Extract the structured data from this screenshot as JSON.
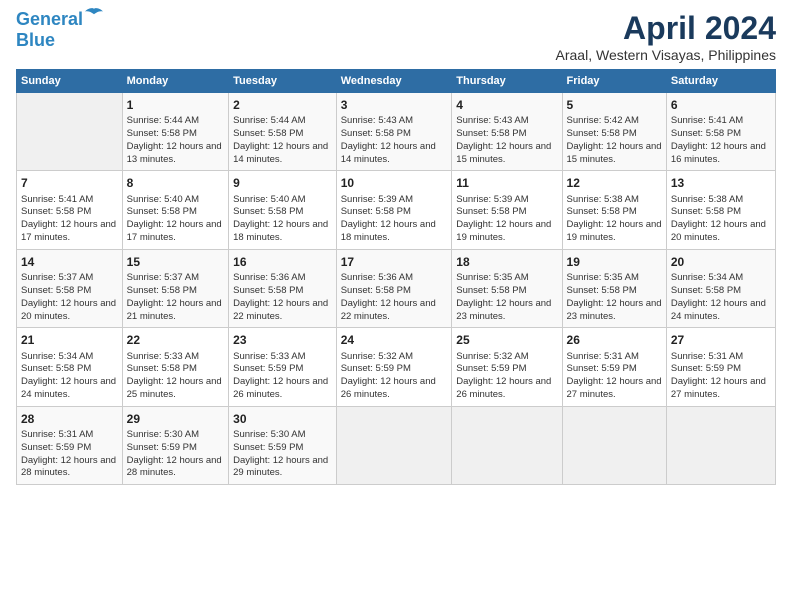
{
  "logo": {
    "line1": "General",
    "line2": "Blue"
  },
  "title": "April 2024",
  "subtitle": "Araal, Western Visayas, Philippines",
  "days_header": [
    "Sunday",
    "Monday",
    "Tuesday",
    "Wednesday",
    "Thursday",
    "Friday",
    "Saturday"
  ],
  "weeks": [
    [
      {
        "num": "",
        "sunrise": "",
        "sunset": "",
        "daylight": ""
      },
      {
        "num": "1",
        "sunrise": "Sunrise: 5:44 AM",
        "sunset": "Sunset: 5:58 PM",
        "daylight": "Daylight: 12 hours and 13 minutes."
      },
      {
        "num": "2",
        "sunrise": "Sunrise: 5:44 AM",
        "sunset": "Sunset: 5:58 PM",
        "daylight": "Daylight: 12 hours and 14 minutes."
      },
      {
        "num": "3",
        "sunrise": "Sunrise: 5:43 AM",
        "sunset": "Sunset: 5:58 PM",
        "daylight": "Daylight: 12 hours and 14 minutes."
      },
      {
        "num": "4",
        "sunrise": "Sunrise: 5:43 AM",
        "sunset": "Sunset: 5:58 PM",
        "daylight": "Daylight: 12 hours and 15 minutes."
      },
      {
        "num": "5",
        "sunrise": "Sunrise: 5:42 AM",
        "sunset": "Sunset: 5:58 PM",
        "daylight": "Daylight: 12 hours and 15 minutes."
      },
      {
        "num": "6",
        "sunrise": "Sunrise: 5:41 AM",
        "sunset": "Sunset: 5:58 PM",
        "daylight": "Daylight: 12 hours and 16 minutes."
      }
    ],
    [
      {
        "num": "7",
        "sunrise": "Sunrise: 5:41 AM",
        "sunset": "Sunset: 5:58 PM",
        "daylight": "Daylight: 12 hours and 17 minutes."
      },
      {
        "num": "8",
        "sunrise": "Sunrise: 5:40 AM",
        "sunset": "Sunset: 5:58 PM",
        "daylight": "Daylight: 12 hours and 17 minutes."
      },
      {
        "num": "9",
        "sunrise": "Sunrise: 5:40 AM",
        "sunset": "Sunset: 5:58 PM",
        "daylight": "Daylight: 12 hours and 18 minutes."
      },
      {
        "num": "10",
        "sunrise": "Sunrise: 5:39 AM",
        "sunset": "Sunset: 5:58 PM",
        "daylight": "Daylight: 12 hours and 18 minutes."
      },
      {
        "num": "11",
        "sunrise": "Sunrise: 5:39 AM",
        "sunset": "Sunset: 5:58 PM",
        "daylight": "Daylight: 12 hours and 19 minutes."
      },
      {
        "num": "12",
        "sunrise": "Sunrise: 5:38 AM",
        "sunset": "Sunset: 5:58 PM",
        "daylight": "Daylight: 12 hours and 19 minutes."
      },
      {
        "num": "13",
        "sunrise": "Sunrise: 5:38 AM",
        "sunset": "Sunset: 5:58 PM",
        "daylight": "Daylight: 12 hours and 20 minutes."
      }
    ],
    [
      {
        "num": "14",
        "sunrise": "Sunrise: 5:37 AM",
        "sunset": "Sunset: 5:58 PM",
        "daylight": "Daylight: 12 hours and 20 minutes."
      },
      {
        "num": "15",
        "sunrise": "Sunrise: 5:37 AM",
        "sunset": "Sunset: 5:58 PM",
        "daylight": "Daylight: 12 hours and 21 minutes."
      },
      {
        "num": "16",
        "sunrise": "Sunrise: 5:36 AM",
        "sunset": "Sunset: 5:58 PM",
        "daylight": "Daylight: 12 hours and 22 minutes."
      },
      {
        "num": "17",
        "sunrise": "Sunrise: 5:36 AM",
        "sunset": "Sunset: 5:58 PM",
        "daylight": "Daylight: 12 hours and 22 minutes."
      },
      {
        "num": "18",
        "sunrise": "Sunrise: 5:35 AM",
        "sunset": "Sunset: 5:58 PM",
        "daylight": "Daylight: 12 hours and 23 minutes."
      },
      {
        "num": "19",
        "sunrise": "Sunrise: 5:35 AM",
        "sunset": "Sunset: 5:58 PM",
        "daylight": "Daylight: 12 hours and 23 minutes."
      },
      {
        "num": "20",
        "sunrise": "Sunrise: 5:34 AM",
        "sunset": "Sunset: 5:58 PM",
        "daylight": "Daylight: 12 hours and 24 minutes."
      }
    ],
    [
      {
        "num": "21",
        "sunrise": "Sunrise: 5:34 AM",
        "sunset": "Sunset: 5:58 PM",
        "daylight": "Daylight: 12 hours and 24 minutes."
      },
      {
        "num": "22",
        "sunrise": "Sunrise: 5:33 AM",
        "sunset": "Sunset: 5:58 PM",
        "daylight": "Daylight: 12 hours and 25 minutes."
      },
      {
        "num": "23",
        "sunrise": "Sunrise: 5:33 AM",
        "sunset": "Sunset: 5:59 PM",
        "daylight": "Daylight: 12 hours and 26 minutes."
      },
      {
        "num": "24",
        "sunrise": "Sunrise: 5:32 AM",
        "sunset": "Sunset: 5:59 PM",
        "daylight": "Daylight: 12 hours and 26 minutes."
      },
      {
        "num": "25",
        "sunrise": "Sunrise: 5:32 AM",
        "sunset": "Sunset: 5:59 PM",
        "daylight": "Daylight: 12 hours and 26 minutes."
      },
      {
        "num": "26",
        "sunrise": "Sunrise: 5:31 AM",
        "sunset": "Sunset: 5:59 PM",
        "daylight": "Daylight: 12 hours and 27 minutes."
      },
      {
        "num": "27",
        "sunrise": "Sunrise: 5:31 AM",
        "sunset": "Sunset: 5:59 PM",
        "daylight": "Daylight: 12 hours and 27 minutes."
      }
    ],
    [
      {
        "num": "28",
        "sunrise": "Sunrise: 5:31 AM",
        "sunset": "Sunset: 5:59 PM",
        "daylight": "Daylight: 12 hours and 28 minutes."
      },
      {
        "num": "29",
        "sunrise": "Sunrise: 5:30 AM",
        "sunset": "Sunset: 5:59 PM",
        "daylight": "Daylight: 12 hours and 28 minutes."
      },
      {
        "num": "30",
        "sunrise": "Sunrise: 5:30 AM",
        "sunset": "Sunset: 5:59 PM",
        "daylight": "Daylight: 12 hours and 29 minutes."
      },
      {
        "num": "",
        "sunrise": "",
        "sunset": "",
        "daylight": ""
      },
      {
        "num": "",
        "sunrise": "",
        "sunset": "",
        "daylight": ""
      },
      {
        "num": "",
        "sunrise": "",
        "sunset": "",
        "daylight": ""
      },
      {
        "num": "",
        "sunrise": "",
        "sunset": "",
        "daylight": ""
      }
    ]
  ]
}
